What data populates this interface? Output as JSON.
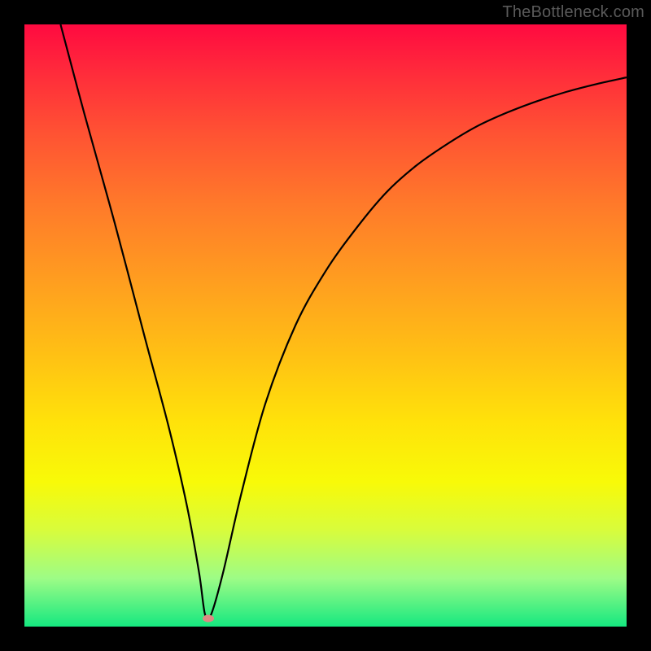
{
  "watermark": "TheBottleneck.com",
  "chart_data": {
    "type": "line",
    "title": "",
    "xlabel": "",
    "ylabel": "",
    "xlim": [
      0,
      100
    ],
    "ylim": [
      0,
      100
    ],
    "series": [
      {
        "name": "curve",
        "x": [
          6,
          10,
          15,
          20,
          24,
          27,
          29,
          30,
          31,
          33,
          36,
          40,
          45,
          50,
          55,
          60,
          65,
          70,
          75,
          80,
          85,
          90,
          95,
          100
        ],
        "values": [
          100,
          85,
          67,
          48,
          33,
          20,
          9,
          2,
          2,
          9,
          22,
          37,
          50,
          59,
          66,
          72,
          76.5,
          80,
          83,
          85.3,
          87.2,
          88.8,
          90.1,
          91.2
        ]
      }
    ],
    "minimum_marker": {
      "x": 30.5,
      "y": 1.3
    },
    "gradient_stops": [
      {
        "pos": 0,
        "color": "#ff0a40"
      },
      {
        "pos": 8,
        "color": "#ff2b3b"
      },
      {
        "pos": 18,
        "color": "#ff5233"
      },
      {
        "pos": 30,
        "color": "#ff7a2a"
      },
      {
        "pos": 42,
        "color": "#ff9c20"
      },
      {
        "pos": 54,
        "color": "#ffbe15"
      },
      {
        "pos": 66,
        "color": "#ffe20a"
      },
      {
        "pos": 76,
        "color": "#f8fa08"
      },
      {
        "pos": 84,
        "color": "#d8fc3c"
      },
      {
        "pos": 92,
        "color": "#9dfc86"
      },
      {
        "pos": 100,
        "color": "#15e880"
      }
    ]
  }
}
